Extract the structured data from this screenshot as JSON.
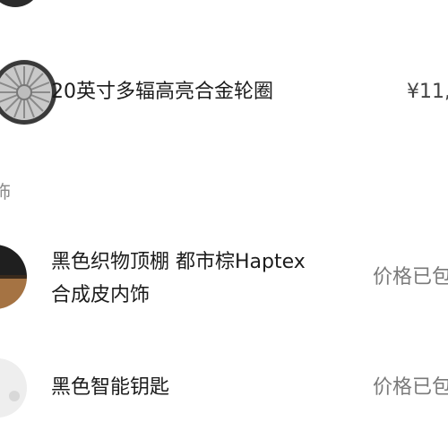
{
  "items": [
    {
      "icon": "alloy-wheel-icon",
      "title": "20英寸多辐高亮合金轮圈",
      "price": "¥11,"
    },
    {
      "icon": "headliner-swatch-icon",
      "title_line1": "黑色织物顶棚 都市棕Haptex",
      "title_line2": "合成皮内饰",
      "price": "价格已包"
    },
    {
      "icon": "smart-key-icon",
      "title": "黑色智能钥匙",
      "price": "价格已包"
    }
  ],
  "section": {
    "label": "饰"
  },
  "colors": {
    "title_text": "#1c1c1c",
    "price_text": "#7a7a7a",
    "section_text": "#8a8a8a",
    "background": "#ffffff"
  }
}
